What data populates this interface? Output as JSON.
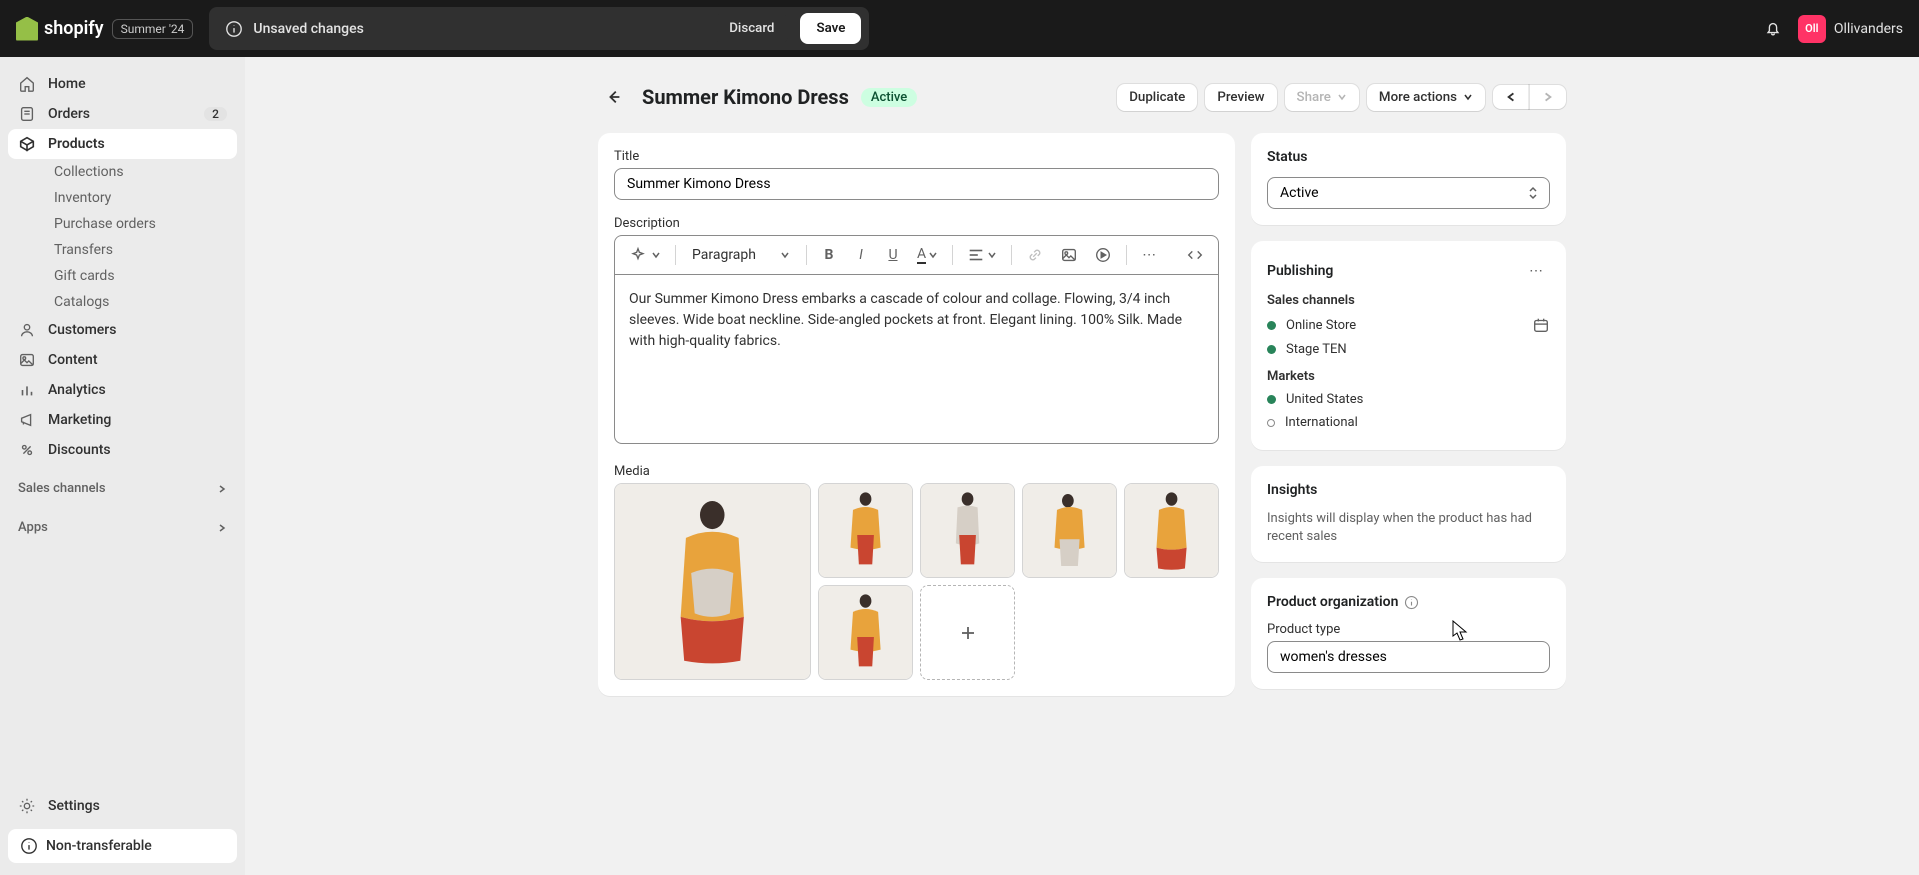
{
  "brand": "shopify",
  "edition_tag": "Summer '24",
  "context_bar": {
    "unsaved_label": "Unsaved changes",
    "discard_label": "Discard",
    "save_label": "Save"
  },
  "user": {
    "name": "Ollivanders",
    "initials": "Oll"
  },
  "sidebar": {
    "home": "Home",
    "orders": "Orders",
    "orders_badge": "2",
    "products": "Products",
    "sub": {
      "collections": "Collections",
      "inventory": "Inventory",
      "purchase_orders": "Purchase orders",
      "transfers": "Transfers",
      "gift_cards": "Gift cards",
      "catalogs": "Catalogs"
    },
    "customers": "Customers",
    "content": "Content",
    "analytics": "Analytics",
    "marketing": "Marketing",
    "discounts": "Discounts",
    "sales_channels": "Sales channels",
    "apps": "Apps",
    "settings": "Settings",
    "non_transferable": "Non-transferable"
  },
  "page": {
    "title": "Summer Kimono Dress",
    "status_pill": "Active",
    "actions": {
      "duplicate": "Duplicate",
      "preview": "Preview",
      "share": "Share",
      "more": "More actions"
    }
  },
  "form": {
    "title_label": "Title",
    "title_value": "Summer Kimono Dress",
    "description_label": "Description",
    "paragraph_label": "Paragraph",
    "description_text": "Our Summer Kimono Dress embarks a cascade of colour and collage. Flowing, 3/4 inch sleeves. Wide boat neckline. Side-angled pockets at front. Elegant lining. 100% Silk. Made with high-quality fabrics.",
    "media_label": "Media"
  },
  "status_card": {
    "heading": "Status",
    "value": "Active"
  },
  "publishing": {
    "heading": "Publishing",
    "sales_channels_label": "Sales channels",
    "channels": [
      "Online Store",
      "Stage TEN"
    ],
    "markets_label": "Markets",
    "markets": [
      "United States",
      "International"
    ]
  },
  "insights": {
    "heading": "Insights",
    "text": "Insights will display when the product has had recent sales"
  },
  "organization": {
    "heading": "Product organization",
    "type_label": "Product type",
    "type_value": "women's dresses"
  }
}
